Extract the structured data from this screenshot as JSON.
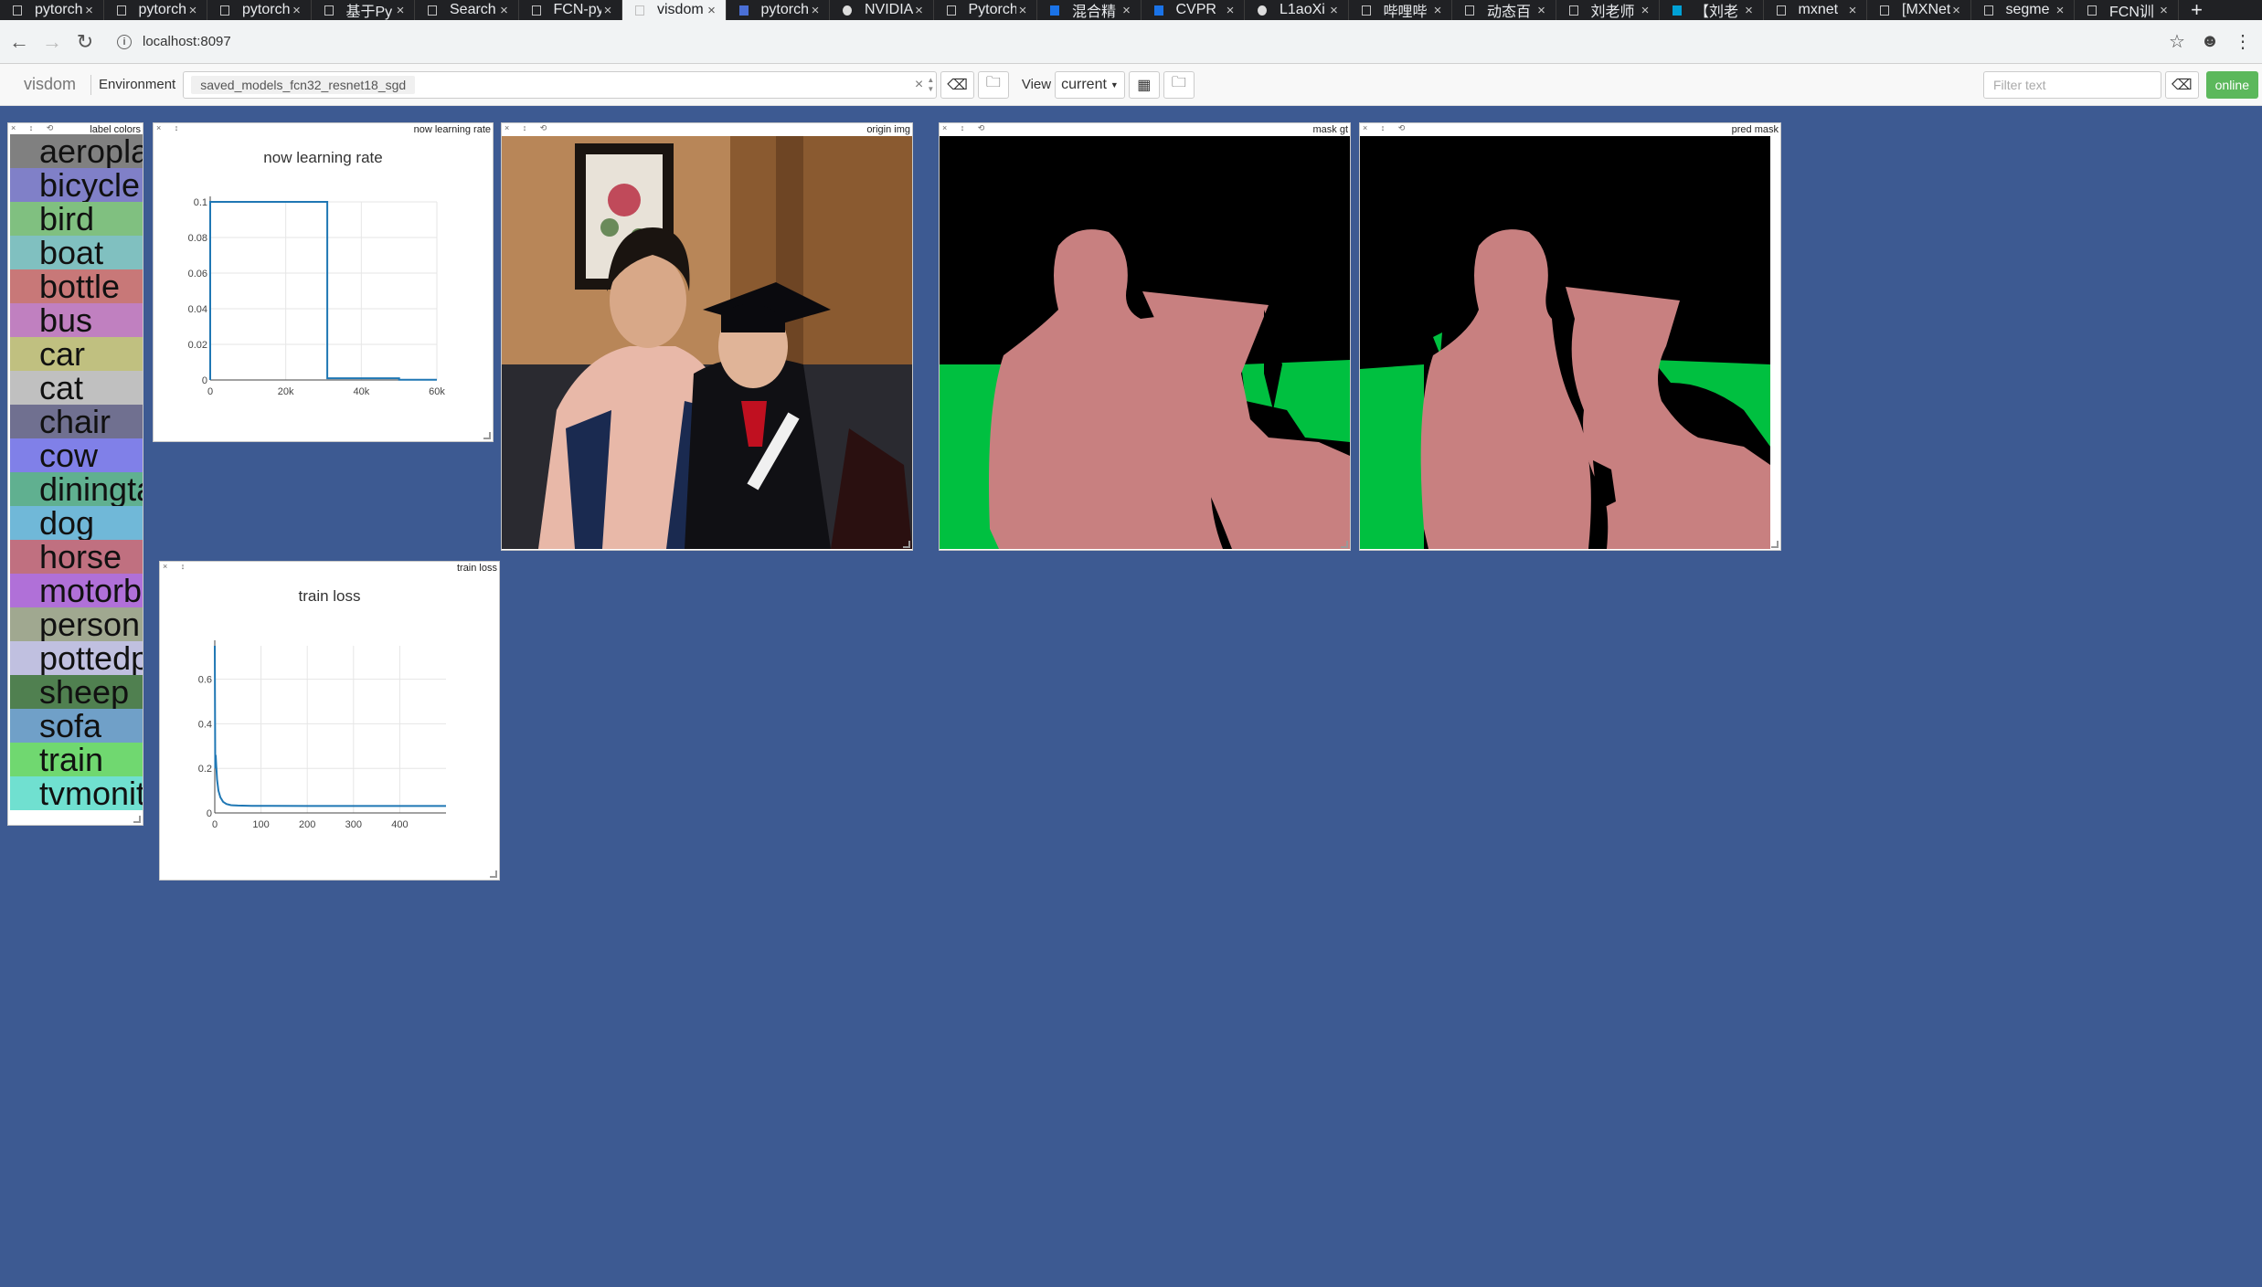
{
  "browser": {
    "tabs": [
      {
        "label": "pytorch",
        "icon": "doc-icon"
      },
      {
        "label": "pytorch",
        "icon": "doc-icon"
      },
      {
        "label": "pytorch",
        "icon": "doc-icon"
      },
      {
        "label": "基于Py",
        "icon": "doc-icon"
      },
      {
        "label": "Search",
        "icon": "doc-icon"
      },
      {
        "label": "FCN-py",
        "icon": "doc-icon"
      },
      {
        "label": "visdom",
        "icon": "doc-icon",
        "active": true
      },
      {
        "label": "pytorch",
        "icon": "grid-icon"
      },
      {
        "label": "NVIDIA",
        "icon": "github-icon"
      },
      {
        "label": "Pytorch",
        "icon": "doc-icon"
      },
      {
        "label": "混合精",
        "icon": "cloud-icon"
      },
      {
        "label": "CVPR",
        "icon": "cvpr-icon"
      },
      {
        "label": "L1aoXi",
        "icon": "github-icon"
      },
      {
        "label": "哔哩哔",
        "icon": "doc-icon"
      },
      {
        "label": "动态百",
        "icon": "doc-icon"
      },
      {
        "label": "刘老师",
        "icon": "doc-icon"
      },
      {
        "label": "【刘老",
        "icon": "bilibili-icon"
      },
      {
        "label": "mxnet",
        "icon": "doc-icon"
      },
      {
        "label": "[MXNet",
        "icon": "doc-icon"
      },
      {
        "label": "segme",
        "icon": "doc-icon"
      },
      {
        "label": "FCN训",
        "icon": "doc-icon"
      }
    ],
    "new_tab": "+",
    "url": "localhost:8097"
  },
  "toolbar": {
    "brand": "visdom",
    "env_label": "Environment",
    "env_value": "saved_models_fcn32_resnet18_sgd",
    "env_clear": "×",
    "view_label": "View",
    "view_value": "current",
    "filter_placeholder": "Filter text",
    "online_label": "online"
  },
  "panes": {
    "label_colors": {
      "title": "label colors",
      "items": [
        {
          "name": "aeroplane",
          "color": "#808080"
        },
        {
          "name": "bicycle",
          "color": "#8080c8"
        },
        {
          "name": "bird",
          "color": "#80c080"
        },
        {
          "name": "boat",
          "color": "#80c0c0"
        },
        {
          "name": "bottle",
          "color": "#c87878"
        },
        {
          "name": "bus",
          "color": "#c080c0"
        },
        {
          "name": "car",
          "color": "#c0c080"
        },
        {
          "name": "cat",
          "color": "#c0c0c0"
        },
        {
          "name": "chair",
          "color": "#707090"
        },
        {
          "name": "cow",
          "color": "#8080e8"
        },
        {
          "name": "diningtable",
          "color": "#60b090"
        },
        {
          "name": "dog",
          "color": "#70b8d8"
        },
        {
          "name": "horse",
          "color": "#c07080"
        },
        {
          "name": "motorbike",
          "color": "#b070d8"
        },
        {
          "name": "person",
          "color": "#a0a890"
        },
        {
          "name": "pottedplant",
          "color": "#c0c0e0"
        },
        {
          "name": "sheep",
          "color": "#508050"
        },
        {
          "name": "sofa",
          "color": "#70a0c8"
        },
        {
          "name": "train",
          "color": "#70d870"
        },
        {
          "name": "tvmonitor",
          "color": "#70e0d0"
        }
      ]
    },
    "lr": {
      "title": "now learning rate",
      "chart_title": "now learning rate"
    },
    "loss": {
      "title": "train loss",
      "chart_title": "train loss"
    },
    "origin": {
      "title": "origin img"
    },
    "mask_gt": {
      "title": "mask gt"
    },
    "pred_mask": {
      "title": "pred mask"
    }
  },
  "colors": {
    "background": "#3d5a92",
    "series": "#1f77b4",
    "mask_person": "#c88080",
    "mask_plant": "#00c040"
  },
  "chart_data": [
    {
      "type": "line",
      "title": "now learning rate",
      "xlabel": "",
      "ylabel": "",
      "x_ticks": [
        "0",
        "20k",
        "40k",
        "60k"
      ],
      "y_ticks": [
        "0",
        "0.02",
        "0.04",
        "0.06",
        "0.08",
        "0.1"
      ],
      "xlim": [
        0,
        60000
      ],
      "ylim": [
        0,
        0.1
      ],
      "series": [
        {
          "x": [
            0,
            0,
            31000,
            31000,
            50000,
            50000,
            60000
          ],
          "y": [
            0,
            0.1,
            0.1,
            0.001,
            0.001,
            0.0001,
            0.0001
          ]
        }
      ],
      "grid": true
    },
    {
      "type": "line",
      "title": "train loss",
      "xlabel": "",
      "ylabel": "",
      "x_ticks": [
        "0",
        "100",
        "200",
        "300",
        "400"
      ],
      "y_ticks": [
        "0",
        "0.2",
        "0.4",
        "0.6"
      ],
      "xlim": [
        0,
        500
      ],
      "ylim": [
        0,
        0.75
      ],
      "series": [
        {
          "x": [
            0,
            1,
            2,
            3,
            5,
            8,
            12,
            18,
            25,
            35,
            50,
            80,
            120,
            200,
            300,
            400,
            500
          ],
          "y": [
            0.75,
            0.2,
            0.26,
            0.22,
            0.15,
            0.1,
            0.07,
            0.05,
            0.04,
            0.035,
            0.033,
            0.032,
            0.032,
            0.031,
            0.031,
            0.031,
            0.031
          ]
        }
      ],
      "grid": true
    }
  ]
}
